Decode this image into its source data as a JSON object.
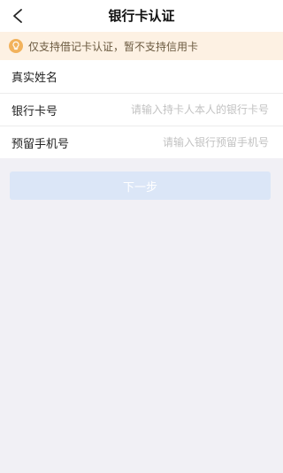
{
  "nav": {
    "title": "银行卡认证"
  },
  "notice": {
    "text": "仅支持借记卡认证，暂不支持信用卡",
    "icon": "lightbulb-icon"
  },
  "form": {
    "rows": [
      {
        "label": "真实姓名",
        "placeholder": ""
      },
      {
        "label": "银行卡号",
        "placeholder": "请输入持卡人本人的银行卡号"
      },
      {
        "label": "预留手机号",
        "placeholder": "请输入银行预留手机号"
      }
    ]
  },
  "actions": {
    "next_label": "下一步"
  },
  "colors": {
    "page_background": "#f1f0f5",
    "notice_background": "#fdf1e3",
    "notice_icon": "#f2b25c",
    "button_disabled": "#dbe6f7"
  }
}
